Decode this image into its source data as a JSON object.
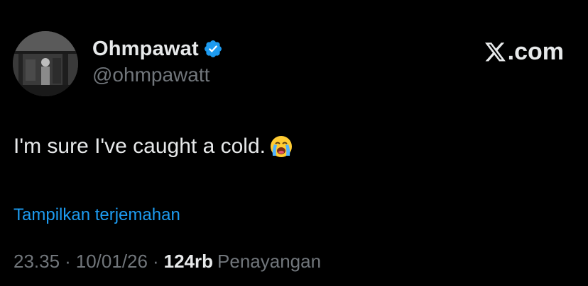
{
  "author": {
    "display_name": "Ohmpawat",
    "handle": "@ohmpawatt",
    "verified": true,
    "verified_icon": "verified-badge-icon",
    "avatar": "profile-photo"
  },
  "brand": {
    "logo_icon": "x-logo-icon",
    "domain_suffix": ".com"
  },
  "tweet": {
    "text": "I'm sure I've caught a cold.",
    "emoji": "loudly-crying-face-emoji"
  },
  "translate_link": "Tampilkan terjemahan",
  "meta": {
    "time": "23.35",
    "separator": "·",
    "date": "10/01/26",
    "views_count": "124rb",
    "views_label": "Penayangan"
  },
  "colors": {
    "background": "#000000",
    "text_primary": "#e7e9ea",
    "text_secondary": "#71767b",
    "link": "#1d9bf0",
    "verified": "#1d9bf0"
  }
}
